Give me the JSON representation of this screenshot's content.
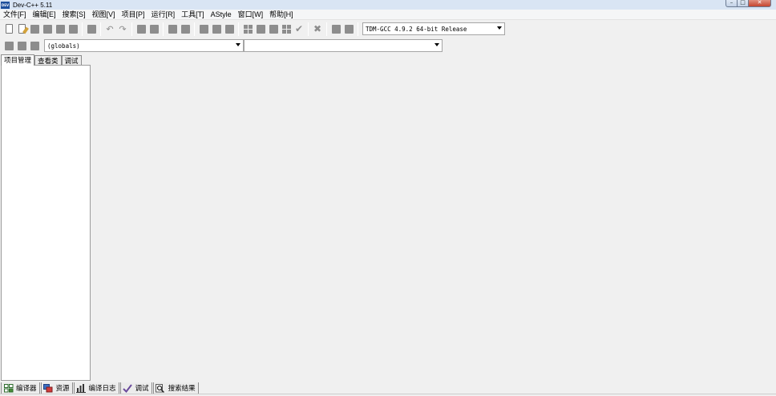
{
  "window": {
    "title": "Dev-C++ 5.11",
    "icon_text": "DEV"
  },
  "menubar": {
    "items": [
      "文件[F]",
      "编辑[E]",
      "搜索[S]",
      "视图[V]",
      "项目[P]",
      "运行[R]",
      "工具[T]",
      "AStyle",
      "窗口[W]",
      "帮助[H]"
    ]
  },
  "toolbar": {
    "compiler_select": "TDM-GCC 4.9.2 64-bit Release",
    "icons": [
      "new-file-icon",
      "open-file-icon",
      "save-icon",
      "save-all-icon",
      "close-icon",
      "close-all-icon",
      "print-icon",
      "undo-icon",
      "redo-icon",
      "find-icon",
      "replace-icon",
      "goto-line-icon",
      "indent-icon",
      "unindent-icon",
      "toggle-comment-icon",
      "new-project-icon",
      "open-project-icon",
      "project-options-icon",
      "grid-icon",
      "compile-icon",
      "stop-icon",
      "chart-icon",
      "profile-icon"
    ]
  },
  "toolbar2": {
    "globals_select": "(globals)",
    "scope_select": ""
  },
  "left_tabs": [
    "项目管理",
    "查看类",
    "调试"
  ],
  "bottom_tabs": [
    {
      "label": "编译器",
      "icon": "compiler-icon"
    },
    {
      "label": "资源",
      "icon": "resources-icon"
    },
    {
      "label": "编译日志",
      "icon": "compile-log-icon"
    },
    {
      "label": "调试",
      "icon": "debug-check-icon"
    },
    {
      "label": "搜索结果",
      "icon": "search-results-icon"
    }
  ],
  "colors": {
    "background": "#f0f0f0",
    "titlebar": "#d9e5f4",
    "close_button": "#c4452f"
  }
}
